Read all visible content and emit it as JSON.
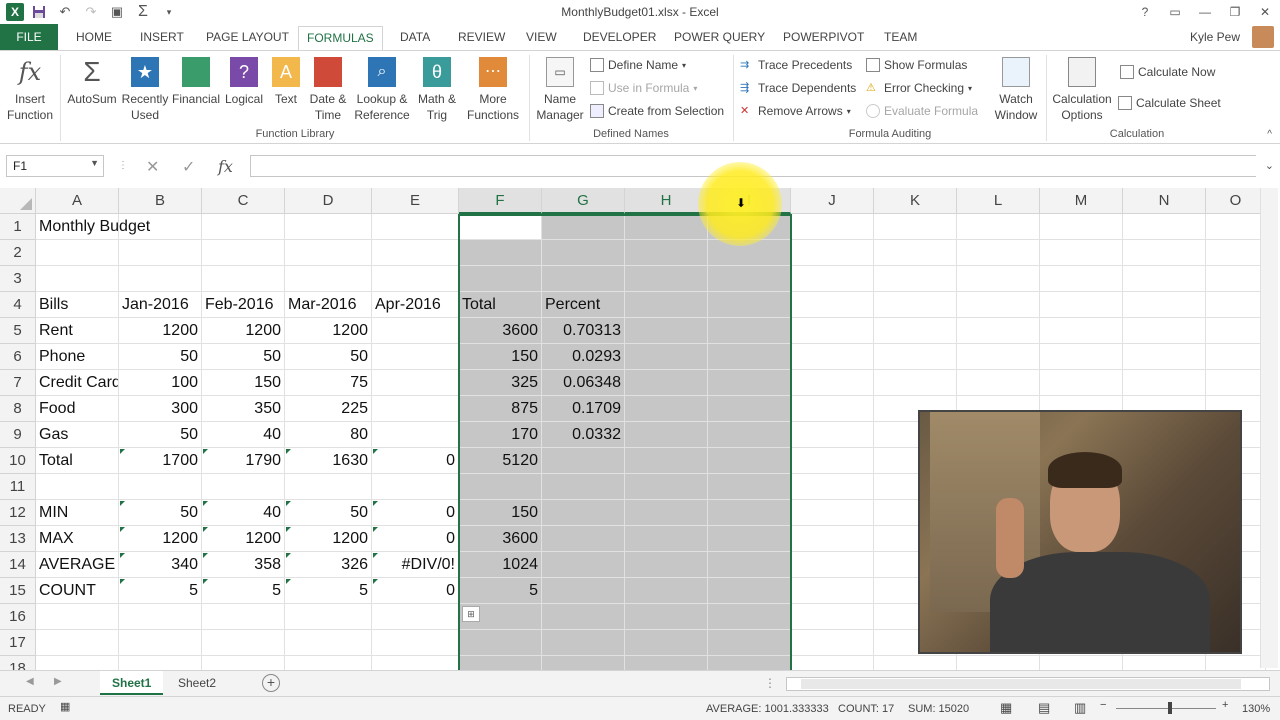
{
  "window": {
    "title": "MonthlyBudget01.xlsx - Excel",
    "logo": "X",
    "user": "Kyle Pew"
  },
  "tabs": [
    {
      "label": "FILE"
    },
    {
      "label": "HOME"
    },
    {
      "label": "INSERT"
    },
    {
      "label": "PAGE LAYOUT"
    },
    {
      "label": "FORMULAS"
    },
    {
      "label": "DATA"
    },
    {
      "label": "REVIEW"
    },
    {
      "label": "VIEW"
    },
    {
      "label": "DEVELOPER"
    },
    {
      "label": "POWER QUERY"
    },
    {
      "label": "POWERPIVOT"
    },
    {
      "label": "TEAM"
    }
  ],
  "ribbon": {
    "insert_function": "Insert Function",
    "library": {
      "autosum": "AutoSum",
      "recently_used": "Recently Used",
      "financial": "Financial",
      "logical": "Logical",
      "text": "Text",
      "date_time": "Date & Time",
      "lookup": "Lookup & Reference",
      "math": "Math & Trig",
      "more": "More Functions",
      "label": "Function Library"
    },
    "names": {
      "name_manager": "Name Manager",
      "define_name": "Define Name",
      "use_in_formula": "Use in Formula",
      "create_from_selection": "Create from Selection",
      "label": "Defined Names"
    },
    "auditing": {
      "trace_precedents": "Trace Precedents",
      "trace_dependents": "Trace Dependents",
      "remove_arrows": "Remove Arrows",
      "show_formulas": "Show Formulas",
      "error_checking": "Error Checking",
      "evaluate_formula": "Evaluate Formula",
      "watch_window": "Watch Window",
      "label": "Formula Auditing"
    },
    "calculation": {
      "options": "Calculation Options",
      "calc_now": "Calculate Now",
      "calc_sheet": "Calculate Sheet",
      "label": "Calculation"
    }
  },
  "formula_bar": {
    "name_box": "F1",
    "value": ""
  },
  "columns": [
    "A",
    "B",
    "C",
    "D",
    "E",
    "F",
    "G",
    "H",
    "I",
    "J",
    "K",
    "L",
    "M",
    "N",
    "O"
  ],
  "rows": [
    "1",
    "2",
    "3",
    "4",
    "5",
    "6",
    "7",
    "8",
    "9",
    "10",
    "11",
    "12",
    "13",
    "14",
    "15",
    "16",
    "17",
    "18"
  ],
  "cells": {
    "A1": "Monthly Budget",
    "A4": "Bills",
    "B4": "Jan-2016",
    "C4": "Feb-2016",
    "D4": "Mar-2016",
    "E4": "Apr-2016",
    "F4": "Total",
    "G4": "Percent",
    "A5": "Rent",
    "B5": "1200",
    "C5": "1200",
    "D5": "1200",
    "F5": "3600",
    "G5": "0.70313",
    "A6": "Phone",
    "B6": "50",
    "C6": "50",
    "D6": "50",
    "F6": "150",
    "G6": "0.0293",
    "A7": "Credit Card",
    "B7": "100",
    "C7": "150",
    "D7": "75",
    "F7": "325",
    "G7": "0.06348",
    "A8": "Food",
    "B8": "300",
    "C8": "350",
    "D8": "225",
    "F8": "875",
    "G8": "0.1709",
    "A9": "Gas",
    "B9": "50",
    "C9": "40",
    "D9": "80",
    "F9": "170",
    "G9": "0.0332",
    "A10": "Total",
    "B10": "1700",
    "C10": "1790",
    "D10": "1630",
    "E10": "0",
    "F10": "5120",
    "A12": "MIN",
    "B12": "50",
    "C12": "40",
    "D12": "50",
    "E12": "0",
    "F12": "150",
    "A13": "MAX",
    "B13": "1200",
    "C13": "1200",
    "D13": "1200",
    "E13": "0",
    "F13": "3600",
    "A14": "AVERAGE",
    "B14": "340",
    "C14": "358",
    "D14": "326",
    "E14": "#DIV/0!",
    "F14": "1024",
    "A15": "COUNT",
    "B15": "5",
    "C15": "5",
    "D15": "5",
    "E15": "0",
    "F15": "5"
  },
  "sheets": [
    "Sheet1",
    "Sheet2"
  ],
  "status": {
    "mode": "READY",
    "average": "AVERAGE: 1001.333333",
    "count": "COUNT: 17",
    "sum": "SUM: 15020",
    "zoom": "130%"
  },
  "colors": {
    "accent": "#217346",
    "selection": "#c6c6c6"
  }
}
